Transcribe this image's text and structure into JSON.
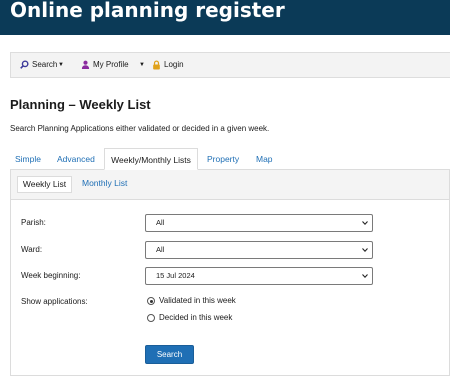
{
  "header": {
    "title": "Online planning register"
  },
  "navbar": {
    "items": [
      {
        "label": "Search",
        "icon": "search-icon",
        "has_dropdown": true
      },
      {
        "label": "My Profile",
        "icon": "user-icon",
        "has_dropdown": true
      },
      {
        "label": "Login",
        "icon": "lock-icon",
        "has_dropdown": false
      }
    ]
  },
  "page": {
    "title_bold": "Planning",
    "title_rest": " – Weekly List",
    "intro": "Search Planning Applications either validated or decided in a given week."
  },
  "tabs": [
    {
      "label": "Simple",
      "active": false
    },
    {
      "label": "Advanced",
      "active": false
    },
    {
      "label": "Weekly/Monthly Lists",
      "active": true
    },
    {
      "label": "Property",
      "active": false
    },
    {
      "label": "Map",
      "active": false
    }
  ],
  "subtabs": [
    {
      "label": "Weekly List",
      "active": true
    },
    {
      "label": "Monthly List",
      "active": false
    }
  ],
  "form": {
    "parish": {
      "label": "Parish:",
      "value": "All"
    },
    "ward": {
      "label": "Ward:",
      "value": "All"
    },
    "week": {
      "label": "Week beginning:",
      "value": "15 Jul 2024"
    },
    "show": {
      "label": "Show applications:",
      "options": [
        {
          "label": "Validated in this week",
          "selected": true
        },
        {
          "label": "Decided in this week",
          "selected": false
        }
      ]
    },
    "submit_label": "Search"
  },
  "colors": {
    "banner": "#0b3a57",
    "link": "#1f6fb5",
    "button": "#1f6fb5",
    "lock_icon": "#e0a21a",
    "user_icon": "#8a2a9e"
  }
}
